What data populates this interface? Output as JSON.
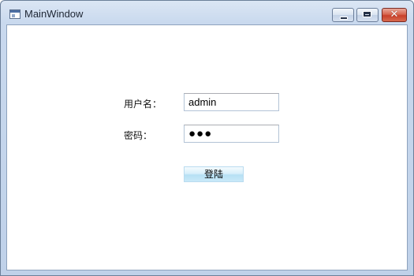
{
  "window": {
    "title": "MainWindow",
    "app_icon": "window-app-icon",
    "controls": {
      "minimize_icon": "minimize-icon",
      "maximize_icon": "maximize-icon",
      "close_glyph": "✕"
    }
  },
  "form": {
    "username_label": "用户名：",
    "username_value": "admin",
    "password_label": "密码：",
    "password_value": "●●●",
    "login_button": "登陆"
  },
  "colors": {
    "titlebar": "#c9d9ee",
    "close_button": "#c8402a",
    "login_button": "#c9e9f8"
  }
}
